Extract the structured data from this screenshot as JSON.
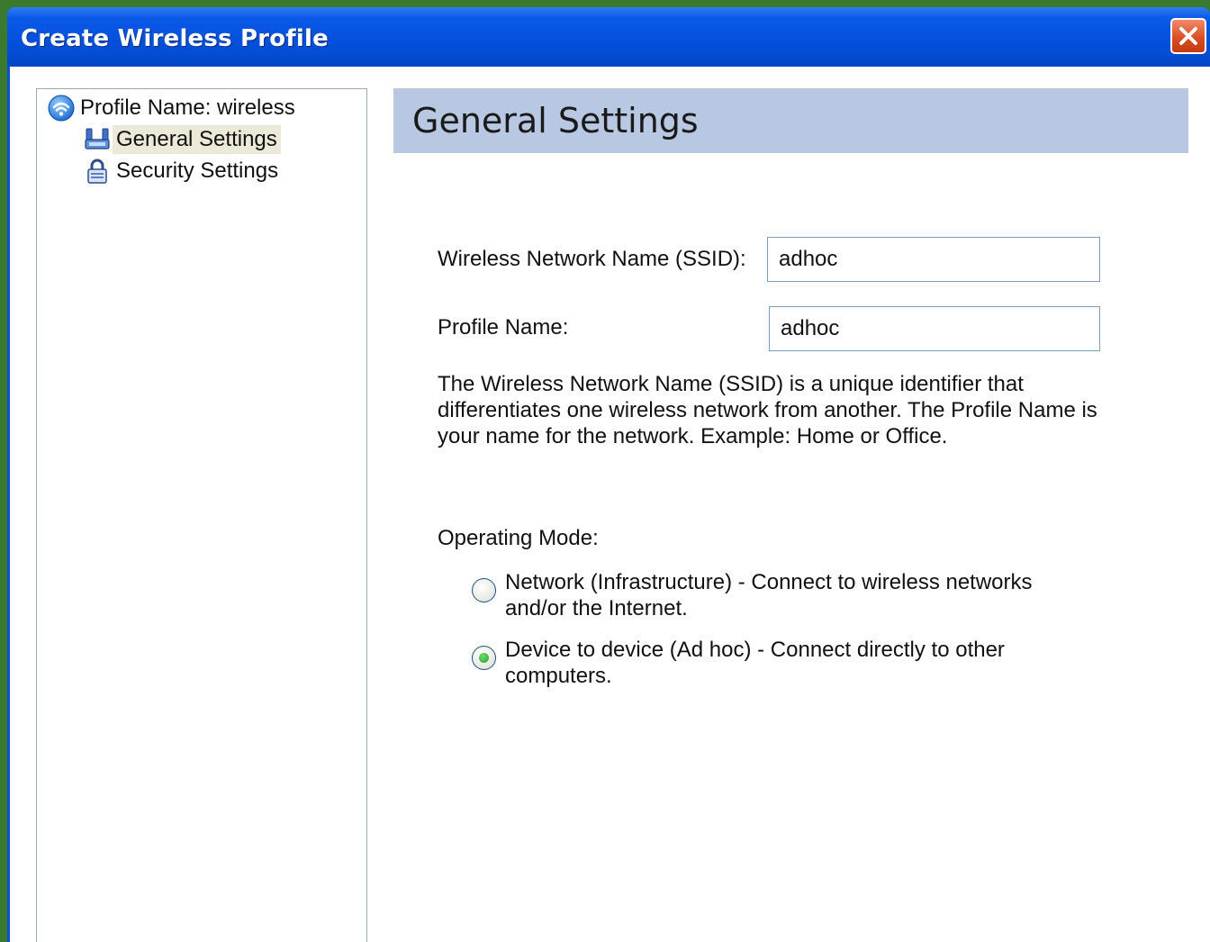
{
  "window": {
    "title": "Create Wireless Profile",
    "close_icon": "close-icon"
  },
  "tree": {
    "root": {
      "label": "Profile Name: wireless",
      "icon": "wireless-icon"
    },
    "items": [
      {
        "label": "General Settings",
        "icon": "network-icon",
        "selected": true
      },
      {
        "label": "Security Settings",
        "icon": "lock-icon",
        "selected": false
      }
    ]
  },
  "panel": {
    "header": "General Settings",
    "ssid": {
      "label": "Wireless Network Name (SSID):",
      "value": "adhoc"
    },
    "profile": {
      "label": "Profile Name:",
      "value": "adhoc"
    },
    "description": "The Wireless Network Name (SSID) is a unique identifier that differentiates one wireless network from another. The Profile Name is your name for the network. Example: Home or Office.",
    "operating_mode": {
      "label": "Operating Mode:",
      "options": [
        {
          "label": "Network (Infrastructure) - Connect to wireless networks and/or the Internet.",
          "selected": false
        },
        {
          "label": "Device to device (Ad hoc) - Connect directly to other computers.",
          "selected": true
        }
      ]
    }
  },
  "colors": {
    "titlebar": "#0551dc",
    "header_band": "#b8c8e3",
    "selected_item": "#ece9d8",
    "radio_selected": "#21a121"
  }
}
